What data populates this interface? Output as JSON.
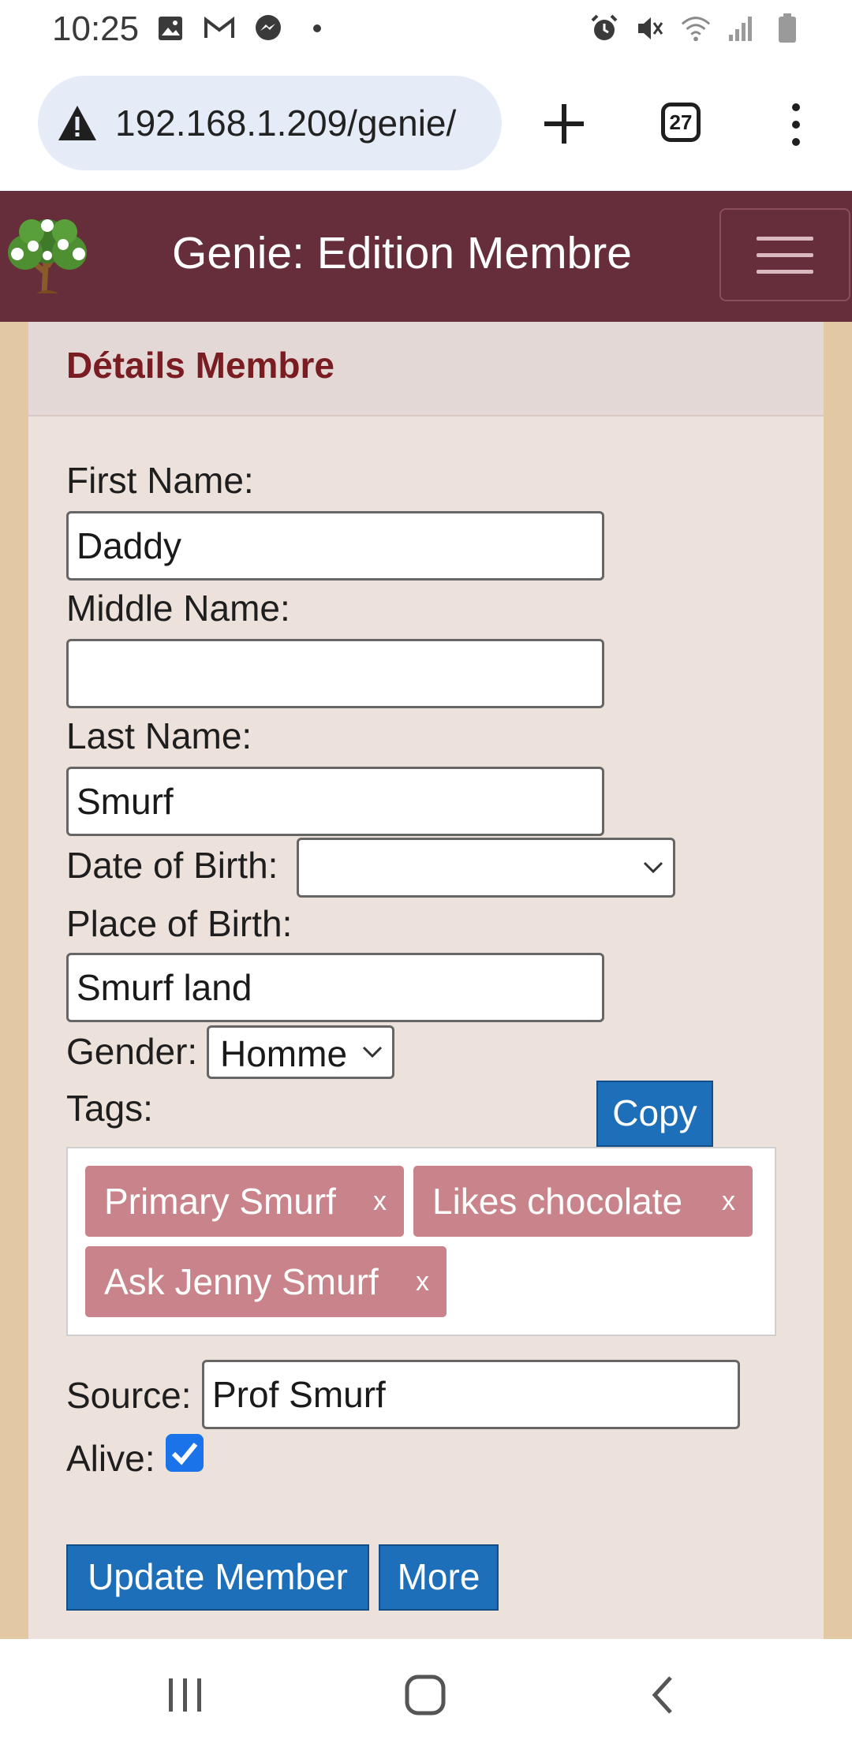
{
  "status_bar": {
    "time": "10:25",
    "left_icons": [
      "image-icon",
      "gmail-icon",
      "messenger-icon",
      "dot-icon"
    ],
    "right_icons": [
      "alarm-icon",
      "mute-icon",
      "wifi-icon",
      "signal-icon",
      "battery-icon"
    ]
  },
  "browser": {
    "url": "192.168.1.209/genie/",
    "tab_count": "27"
  },
  "app": {
    "title": "Genie: Edition Membre"
  },
  "card": {
    "title": "Détails Membre"
  },
  "form": {
    "first_name_label": "First Name:",
    "first_name_value": "Daddy",
    "middle_name_label": "Middle Name:",
    "middle_name_value": "",
    "last_name_label": "Last Name:",
    "last_name_value": "Smurf",
    "dob_label": "Date of Birth:",
    "dob_value": "",
    "pob_label": "Place of Birth:",
    "pob_value": "Smurf land",
    "gender_label": "Gender:",
    "gender_value": "Homme",
    "tags_label": "Tags:",
    "copy_label": "Copy",
    "tags": [
      {
        "label": "Primary Smurf",
        "remove": "x"
      },
      {
        "label": "Likes chocolate",
        "remove": "x"
      },
      {
        "label": "Ask Jenny Smurf",
        "remove": "x"
      }
    ],
    "source_label": "Source:",
    "source_value": "Prof Smurf",
    "alive_label": "Alive:",
    "alive_checked": true,
    "update_label": "Update Member",
    "more_label": "More"
  },
  "colors": {
    "appbar": "#662e3a",
    "card_title": "#7a1d22",
    "button": "#1c6fb8",
    "tag": "#c8848a",
    "background": "#e3c9a3"
  }
}
